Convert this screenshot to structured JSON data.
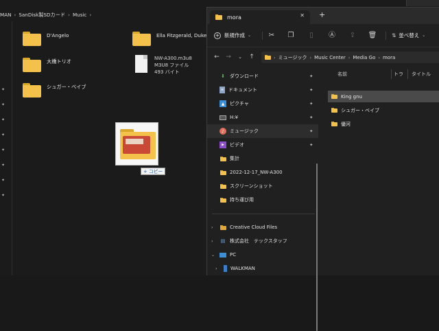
{
  "background_window": {
    "breadcrumb": [
      "MAN",
      "SanDisk製SDカード",
      "Music"
    ],
    "tiles": [
      {
        "label": "D'Angelo"
      },
      {
        "label": "Ella Fitzgerald, Duke El"
      },
      {
        "label": "大橋トリオ"
      },
      {
        "label": "シュガー・ベイブ"
      }
    ],
    "file": {
      "name": "NW-A300.m3u8",
      "type": "M3U8 ファイル",
      "size": "493 バイト"
    },
    "drag_tooltip": "+ コピー"
  },
  "window": {
    "tab_title": "mora",
    "tab_close": "✕",
    "new_tab": "+",
    "toolbar": {
      "new_label": "新規作成",
      "sort_label": "並べ替え"
    },
    "address": [
      "ミュージック",
      "Music Center",
      "Media Go",
      "mora"
    ],
    "nav": [
      {
        "label": "ダウンロード",
        "icon": "download-icon",
        "pinned": true
      },
      {
        "label": "ドキュメント",
        "icon": "document-icon",
        "pinned": true
      },
      {
        "label": "ピクチャ",
        "icon": "picture-icon",
        "pinned": true
      },
      {
        "label": "H:¥",
        "icon": "drive-icon",
        "pinned": true
      },
      {
        "label": "ミュージック",
        "icon": "music-icon",
        "pinned": true,
        "selected": true
      },
      {
        "label": "ビデオ",
        "icon": "video-icon",
        "pinned": true
      },
      {
        "label": "集計",
        "icon": "folder-icon"
      },
      {
        "label": "2022-12-17_NW-A300",
        "icon": "folder-icon"
      },
      {
        "label": "スクリーンショット",
        "icon": "folder-icon"
      },
      {
        "label": "持ち運び用",
        "icon": "folder-icon"
      },
      {
        "label": "Creative Cloud Files",
        "icon": "creative-cloud-icon"
      },
      {
        "label": "株式会社　テックスタッフ",
        "icon": "cloud-folder-icon"
      },
      {
        "label": "PC",
        "icon": "pc-icon"
      },
      {
        "label": "WALKMAN",
        "icon": "walkman-icon"
      }
    ],
    "columns": {
      "name": "名前",
      "type": "トラ",
      "title": "タイトル"
    },
    "files": [
      {
        "name": "King gnu",
        "selected": true
      },
      {
        "name": "シュガー・ベイブ"
      },
      {
        "name": "優河"
      }
    ]
  }
}
